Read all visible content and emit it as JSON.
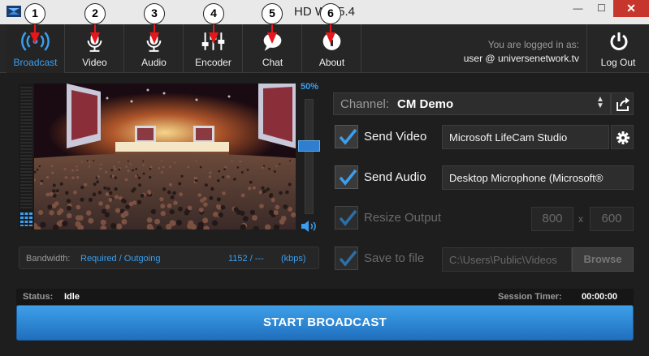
{
  "window": {
    "title": "HD WE 5.4",
    "minimize_glyph": "—",
    "maximize_glyph": "☐",
    "close_glyph": "✕"
  },
  "toolbar": {
    "items": [
      {
        "label": "Broadcast",
        "icon": "broadcast-icon",
        "active": true,
        "callout": "1"
      },
      {
        "label": "Video",
        "icon": "video-mic-icon",
        "active": false,
        "callout": "2"
      },
      {
        "label": "Audio",
        "icon": "audio-mic-icon",
        "active": false,
        "callout": "3"
      },
      {
        "label": "Encoder",
        "icon": "encoder-sliders-icon",
        "active": false,
        "callout": "4"
      },
      {
        "label": "Chat",
        "icon": "chat-bubble-icon",
        "active": false,
        "callout": "5"
      },
      {
        "label": "About",
        "icon": "info-icon",
        "active": false,
        "callout": "6"
      }
    ],
    "login_prefix": "You are logged in as:",
    "login_user": "user @ universenetwork.tv",
    "logout_label": "Log Out",
    "accent_color": "#3a9ff0",
    "callout_color": "#e8161b"
  },
  "preview": {
    "zoom_label": "50%",
    "volume_level": 0.6
  },
  "bandwidth": {
    "label": "Bandwidth:",
    "kind": "Required / Outgoing",
    "value": "1152 / ---",
    "unit": "(kbps)"
  },
  "settings": {
    "channel_label": "Channel:",
    "channel_value": "CM Demo",
    "send_video_label": "Send Video",
    "send_video_checked": true,
    "video_device": "Microsoft LifeCam Studio",
    "send_audio_label": "Send Audio",
    "send_audio_checked": true,
    "audio_device": "Desktop Microphone (Microsoft®",
    "resize_label": "Resize Output",
    "resize_checked": true,
    "resize_width": "800",
    "resize_x": "x",
    "resize_height": "600",
    "save_label": "Save to file",
    "save_checked": true,
    "save_path": "C:\\Users\\Public\\Videos",
    "browse_label": "Browse"
  },
  "status": {
    "label": "Status:",
    "value": "Idle",
    "timer_label": "Session Timer:",
    "timer_value": "00:00:00"
  },
  "start_button_label": "START BROADCAST"
}
